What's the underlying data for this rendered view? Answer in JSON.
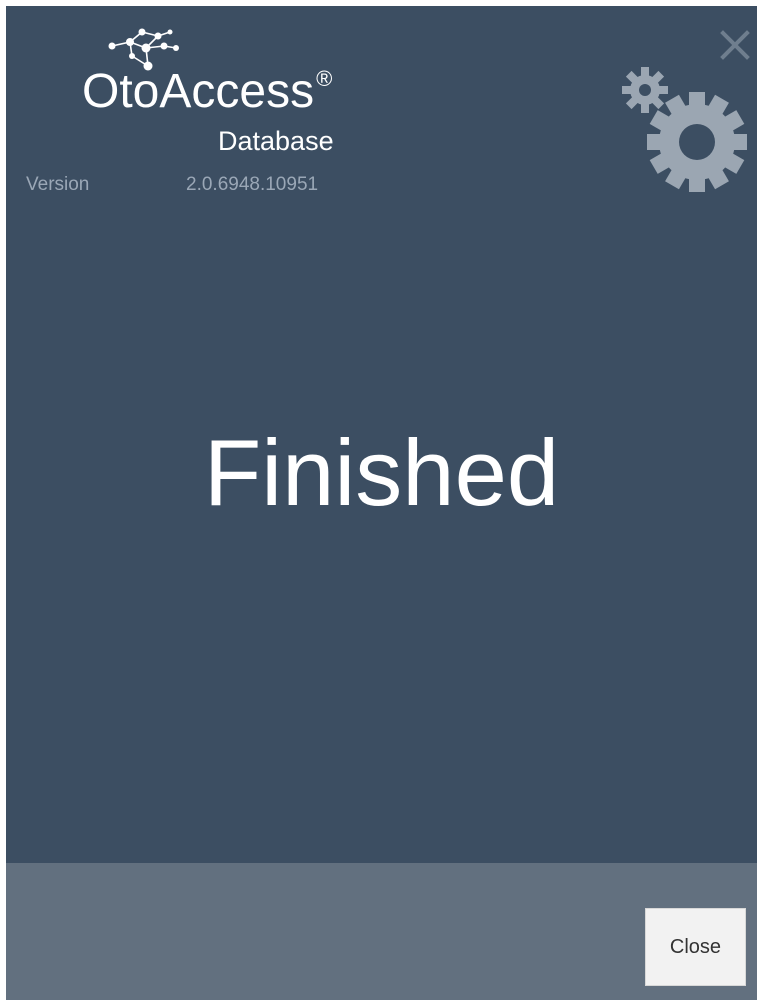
{
  "logo": {
    "name_part1": "Oto",
    "name_part2": "Access",
    "registered": "®",
    "subtitle": "Database"
  },
  "version": {
    "label": "Version",
    "value": "2.0.6948.10951"
  },
  "status": {
    "text": "Finished"
  },
  "footer": {
    "close_label": "Close"
  },
  "icons": {
    "close": "close-icon",
    "gears": "gears-icon",
    "logo_mark": "network-dots-icon"
  },
  "colors": {
    "background": "#3c4e62",
    "footer": "#62707f",
    "gear": "#9ba6b2",
    "close_x": "#6f7e8e",
    "version_text": "#9aa7b6",
    "button_bg": "#f2f2f2"
  }
}
